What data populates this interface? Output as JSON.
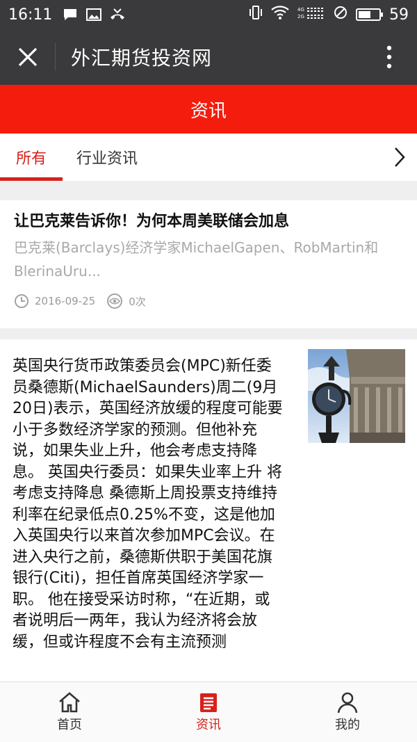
{
  "statusbar": {
    "time": "16:11",
    "battery": "59",
    "battery_level": 0.59
  },
  "titlebar": {
    "title": "外汇期货投资网"
  },
  "header": {
    "title": "资讯"
  },
  "tabs": [
    {
      "label": "所有",
      "active": true
    },
    {
      "label": "行业资讯",
      "active": false
    }
  ],
  "articles": [
    {
      "title": "让巴克莱告诉你！为何本周美联储会加息",
      "summary": "巴克莱(Barclays)经济学家MichaelGapen、RobMartin和BlerinaUru...",
      "date": "2016-09-25",
      "views": "0次"
    },
    {
      "body": "英国央行货币政策委员会(MPC)新任委员桑德斯(MichaelSaunders)周二(9月20日)表示，英国经济放缓的程度可能要小于多数经济学家的预测。但他补充说，如果失业上升，他会考虑支持降息。 英国央行委员：如果失业率上升 将考虑支持降息 桑德斯上周投票支持维持利率在纪录低点0.25%不变，这是他加入英国央行以来首次参加MPC会议。在进入央行之前，桑德斯供职于美国花旗银行(Citi)，担任首席英国经济学家一职。 他在接受采访时称，“在近期，或者说明后一两年，我认为经济将会放缓，但或许程度不会有主流预测"
    }
  ],
  "bottomnav": [
    {
      "label": "首页",
      "active": false
    },
    {
      "label": "资讯",
      "active": true
    },
    {
      "label": "我的",
      "active": false
    }
  ],
  "colors": {
    "accent": "#f41c0d",
    "dark": "#3a3a3c",
    "active_text": "#d8201a"
  }
}
